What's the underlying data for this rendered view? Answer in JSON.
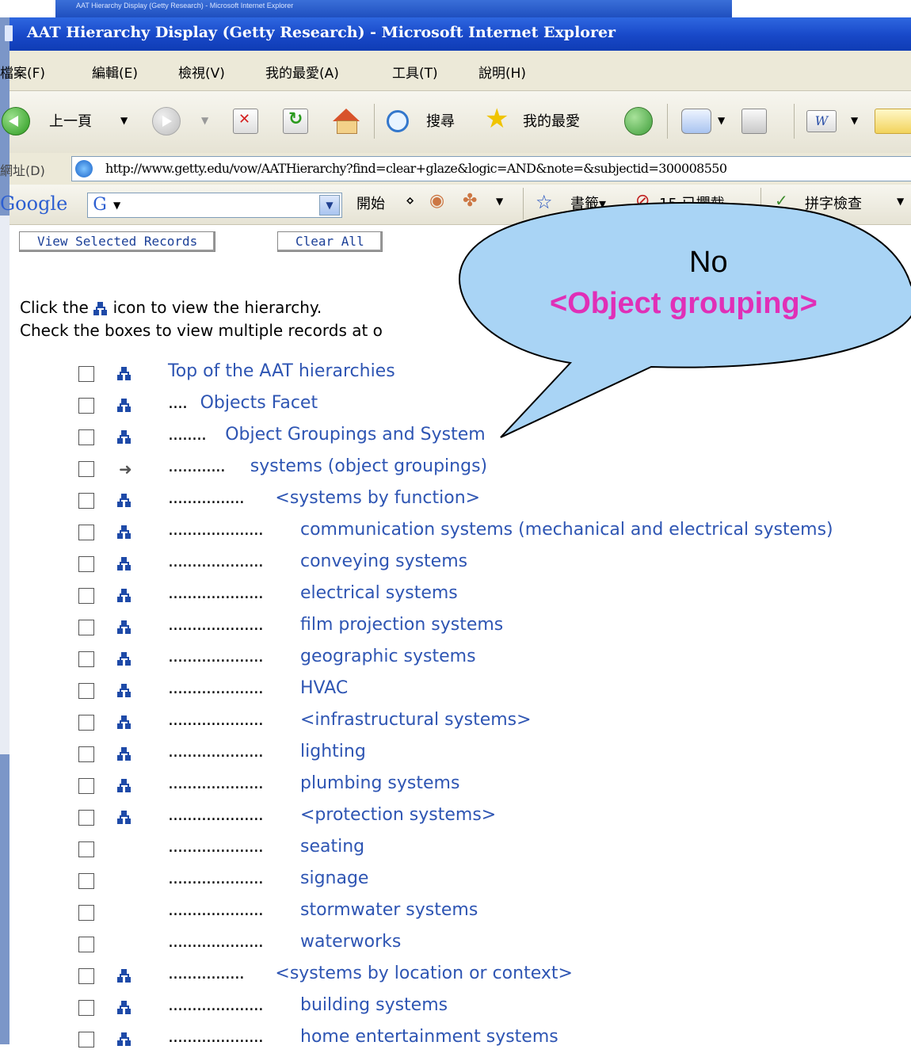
{
  "background_window": {
    "title": "AAT Hierarchy Display (Getty Research) - Microsoft Internet Explorer"
  },
  "window": {
    "title": "AAT Hierarchy Display (Getty Research) - Microsoft Internet Explorer"
  },
  "menu": {
    "items": [
      "檔案(F)",
      "編輯(E)",
      "檢視(V)",
      "我的最愛(A)",
      "工具(T)",
      "說明(H)"
    ]
  },
  "toolbar": {
    "back_label": "上一頁",
    "search_label": "搜尋",
    "favorites_label": "我的最愛"
  },
  "address": {
    "label": "網址(D)",
    "url": "http://www.getty.edu/vow/AATHierarchy?find=clear+glaze&logic=AND&note=&subjectid=300008550"
  },
  "google_bar": {
    "logo": "Google",
    "search_value": "",
    "go_label": "開始",
    "bookmarks_label": "書籤",
    "blocked_label": "15 已攔截",
    "spellcheck_label": "拼字檢查"
  },
  "page": {
    "view_selected_button": "View Selected Records",
    "clear_all_button": "Clear All",
    "intro_line1_pre": "Click the",
    "intro_line1_post": "icon to view the hierarchy.",
    "intro_line2": "Check the boxes to view multiple records at o"
  },
  "hierarchy": [
    {
      "dots": "",
      "label": "Top of the AAT hierarchies",
      "icon": "hierarchy"
    },
    {
      "dots": "....",
      "label": "Objects Facet",
      "icon": "hierarchy"
    },
    {
      "dots": "........",
      "label": "Object Groupings and System",
      "icon": "hierarchy"
    },
    {
      "dots": "............",
      "label": "systems (object groupings)",
      "icon": "arrow"
    },
    {
      "dots": "................",
      "label": "<systems by function>",
      "icon": "hierarchy"
    },
    {
      "dots": "....................",
      "label": "communication systems (mechanical and electrical systems)",
      "icon": "hierarchy"
    },
    {
      "dots": "....................",
      "label": "conveying systems",
      "icon": "hierarchy"
    },
    {
      "dots": "....................",
      "label": "electrical systems",
      "icon": "hierarchy"
    },
    {
      "dots": "....................",
      "label": "film projection systems",
      "icon": "hierarchy"
    },
    {
      "dots": "....................",
      "label": "geographic systems",
      "icon": "hierarchy"
    },
    {
      "dots": "....................",
      "label": "HVAC",
      "icon": "hierarchy"
    },
    {
      "dots": "....................",
      "label": "<infrastructural systems>",
      "icon": "hierarchy"
    },
    {
      "dots": "....................",
      "label": "lighting",
      "icon": "hierarchy"
    },
    {
      "dots": "....................",
      "label": "plumbing systems",
      "icon": "hierarchy"
    },
    {
      "dots": "....................",
      "label": "<protection systems>",
      "icon": "hierarchy"
    },
    {
      "dots": "....................",
      "label": "seating",
      "icon": "none"
    },
    {
      "dots": "....................",
      "label": "signage",
      "icon": "none"
    },
    {
      "dots": "....................",
      "label": "stormwater systems",
      "icon": "none"
    },
    {
      "dots": "....................",
      "label": "waterworks",
      "icon": "none"
    },
    {
      "dots": "................",
      "label": "<systems by location or context>",
      "icon": "hierarchy"
    },
    {
      "dots": "....................",
      "label": "building systems",
      "icon": "hierarchy"
    },
    {
      "dots": "....................",
      "label": "home entertainment systems",
      "icon": "hierarchy"
    }
  ],
  "callout": {
    "line1": "No",
    "line2": "<Object grouping>",
    "fill": "#a9d4f5",
    "text_color": "#e02fb7"
  },
  "colors": {
    "link": "#2e55b3",
    "titlebar": "#1848c8"
  }
}
